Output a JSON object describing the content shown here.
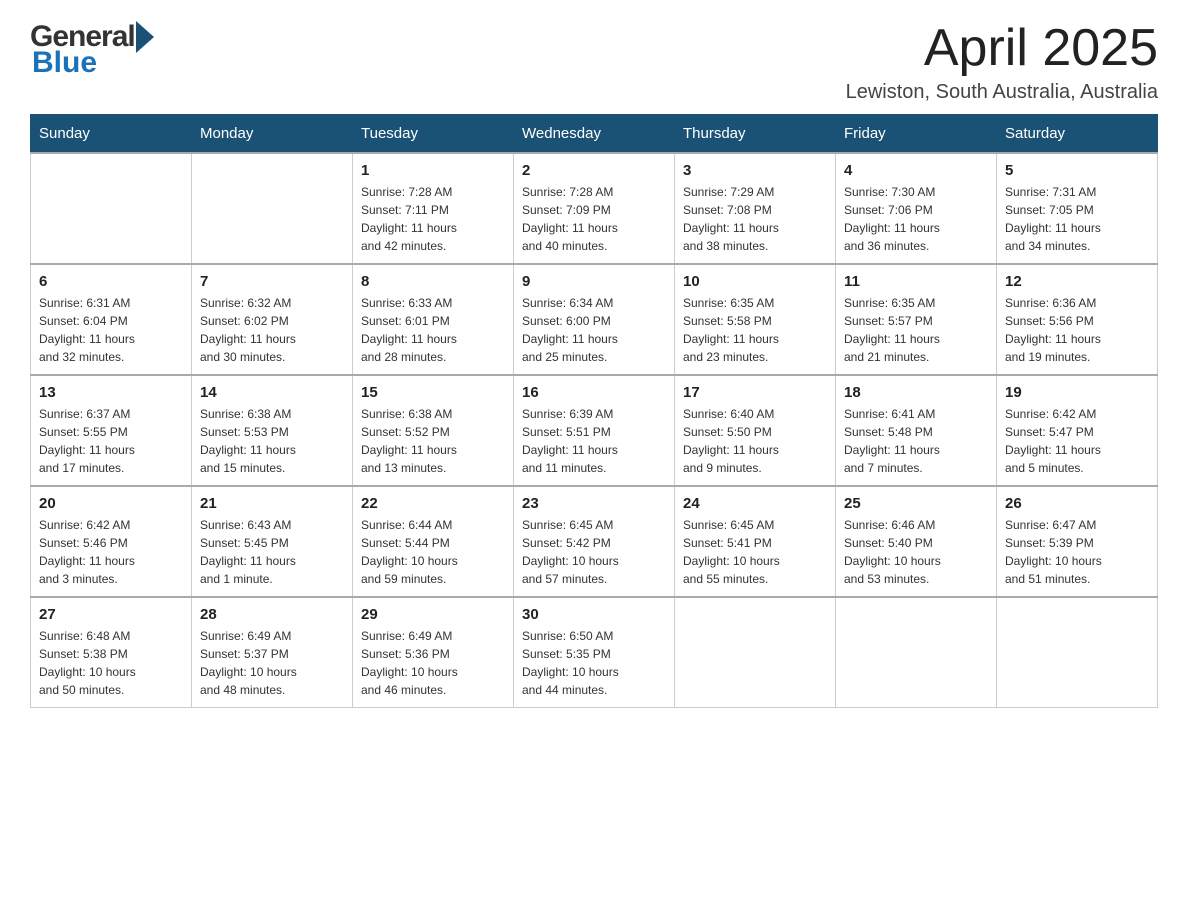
{
  "header": {
    "logo": {
      "general": "General",
      "blue": "Blue"
    },
    "title": "April 2025",
    "location": "Lewiston, South Australia, Australia"
  },
  "calendar": {
    "days_of_week": [
      "Sunday",
      "Monday",
      "Tuesday",
      "Wednesday",
      "Thursday",
      "Friday",
      "Saturday"
    ],
    "weeks": [
      [
        {
          "day": "",
          "info": ""
        },
        {
          "day": "",
          "info": ""
        },
        {
          "day": "1",
          "info": "Sunrise: 7:28 AM\nSunset: 7:11 PM\nDaylight: 11 hours\nand 42 minutes."
        },
        {
          "day": "2",
          "info": "Sunrise: 7:28 AM\nSunset: 7:09 PM\nDaylight: 11 hours\nand 40 minutes."
        },
        {
          "day": "3",
          "info": "Sunrise: 7:29 AM\nSunset: 7:08 PM\nDaylight: 11 hours\nand 38 minutes."
        },
        {
          "day": "4",
          "info": "Sunrise: 7:30 AM\nSunset: 7:06 PM\nDaylight: 11 hours\nand 36 minutes."
        },
        {
          "day": "5",
          "info": "Sunrise: 7:31 AM\nSunset: 7:05 PM\nDaylight: 11 hours\nand 34 minutes."
        }
      ],
      [
        {
          "day": "6",
          "info": "Sunrise: 6:31 AM\nSunset: 6:04 PM\nDaylight: 11 hours\nand 32 minutes."
        },
        {
          "day": "7",
          "info": "Sunrise: 6:32 AM\nSunset: 6:02 PM\nDaylight: 11 hours\nand 30 minutes."
        },
        {
          "day": "8",
          "info": "Sunrise: 6:33 AM\nSunset: 6:01 PM\nDaylight: 11 hours\nand 28 minutes."
        },
        {
          "day": "9",
          "info": "Sunrise: 6:34 AM\nSunset: 6:00 PM\nDaylight: 11 hours\nand 25 minutes."
        },
        {
          "day": "10",
          "info": "Sunrise: 6:35 AM\nSunset: 5:58 PM\nDaylight: 11 hours\nand 23 minutes."
        },
        {
          "day": "11",
          "info": "Sunrise: 6:35 AM\nSunset: 5:57 PM\nDaylight: 11 hours\nand 21 minutes."
        },
        {
          "day": "12",
          "info": "Sunrise: 6:36 AM\nSunset: 5:56 PM\nDaylight: 11 hours\nand 19 minutes."
        }
      ],
      [
        {
          "day": "13",
          "info": "Sunrise: 6:37 AM\nSunset: 5:55 PM\nDaylight: 11 hours\nand 17 minutes."
        },
        {
          "day": "14",
          "info": "Sunrise: 6:38 AM\nSunset: 5:53 PM\nDaylight: 11 hours\nand 15 minutes."
        },
        {
          "day": "15",
          "info": "Sunrise: 6:38 AM\nSunset: 5:52 PM\nDaylight: 11 hours\nand 13 minutes."
        },
        {
          "day": "16",
          "info": "Sunrise: 6:39 AM\nSunset: 5:51 PM\nDaylight: 11 hours\nand 11 minutes."
        },
        {
          "day": "17",
          "info": "Sunrise: 6:40 AM\nSunset: 5:50 PM\nDaylight: 11 hours\nand 9 minutes."
        },
        {
          "day": "18",
          "info": "Sunrise: 6:41 AM\nSunset: 5:48 PM\nDaylight: 11 hours\nand 7 minutes."
        },
        {
          "day": "19",
          "info": "Sunrise: 6:42 AM\nSunset: 5:47 PM\nDaylight: 11 hours\nand 5 minutes."
        }
      ],
      [
        {
          "day": "20",
          "info": "Sunrise: 6:42 AM\nSunset: 5:46 PM\nDaylight: 11 hours\nand 3 minutes."
        },
        {
          "day": "21",
          "info": "Sunrise: 6:43 AM\nSunset: 5:45 PM\nDaylight: 11 hours\nand 1 minute."
        },
        {
          "day": "22",
          "info": "Sunrise: 6:44 AM\nSunset: 5:44 PM\nDaylight: 10 hours\nand 59 minutes."
        },
        {
          "day": "23",
          "info": "Sunrise: 6:45 AM\nSunset: 5:42 PM\nDaylight: 10 hours\nand 57 minutes."
        },
        {
          "day": "24",
          "info": "Sunrise: 6:45 AM\nSunset: 5:41 PM\nDaylight: 10 hours\nand 55 minutes."
        },
        {
          "day": "25",
          "info": "Sunrise: 6:46 AM\nSunset: 5:40 PM\nDaylight: 10 hours\nand 53 minutes."
        },
        {
          "day": "26",
          "info": "Sunrise: 6:47 AM\nSunset: 5:39 PM\nDaylight: 10 hours\nand 51 minutes."
        }
      ],
      [
        {
          "day": "27",
          "info": "Sunrise: 6:48 AM\nSunset: 5:38 PM\nDaylight: 10 hours\nand 50 minutes."
        },
        {
          "day": "28",
          "info": "Sunrise: 6:49 AM\nSunset: 5:37 PM\nDaylight: 10 hours\nand 48 minutes."
        },
        {
          "day": "29",
          "info": "Sunrise: 6:49 AM\nSunset: 5:36 PM\nDaylight: 10 hours\nand 46 minutes."
        },
        {
          "day": "30",
          "info": "Sunrise: 6:50 AM\nSunset: 5:35 PM\nDaylight: 10 hours\nand 44 minutes."
        },
        {
          "day": "",
          "info": ""
        },
        {
          "day": "",
          "info": ""
        },
        {
          "day": "",
          "info": ""
        }
      ]
    ]
  }
}
